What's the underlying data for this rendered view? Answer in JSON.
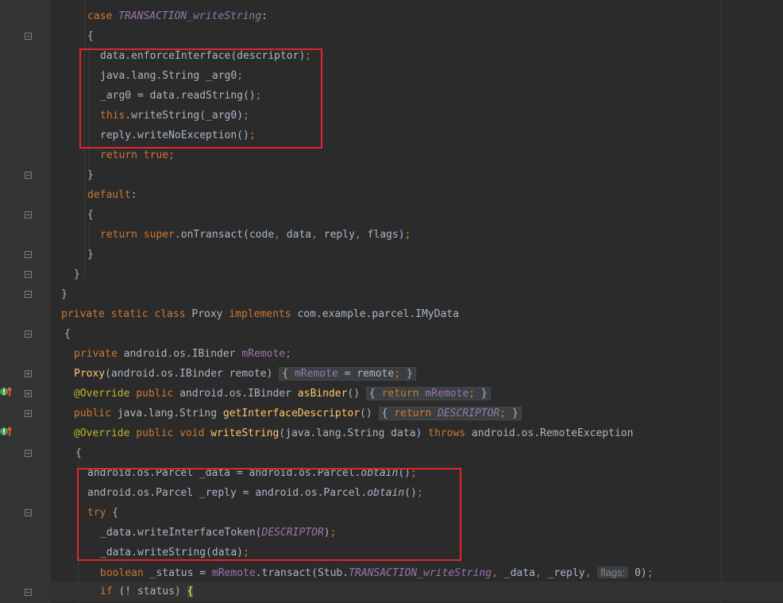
{
  "colors": {
    "background": "#2b2b2b",
    "keyword": "#cc7832",
    "field": "#9876aa",
    "method": "#ffc66d",
    "annotation": "#bbb529",
    "text": "#a9b7c6",
    "highlight_box": "#e0262c"
  },
  "code": {
    "l0": {
      "kw": "case",
      "const": "TRANSACTION_writeString",
      "rest": ":"
    },
    "l1": {
      "t": "{"
    },
    "l2": {
      "a": "data.enforceInterface(descriptor)",
      "b": ";"
    },
    "l3": {
      "a": "java.lang.String _arg0",
      "b": ";"
    },
    "l4": {
      "a": "_arg0 = data.readString()",
      "b": ";"
    },
    "l5": {
      "kw": "this",
      "a": ".writeString(_arg0)",
      "b": ";"
    },
    "l6": {
      "a": "reply.writeNoException()",
      "b": ";"
    },
    "l7": {
      "kw": "return true",
      "b": ";"
    },
    "l8": {
      "t": "}"
    },
    "l9": {
      "kw": "default",
      "rest": ":"
    },
    "l10": {
      "t": "{"
    },
    "l11": {
      "kw1": "return super",
      "a": ".onTransact(code",
      "c1": ",",
      "a2": " data",
      "c2": ",",
      "a3": " reply",
      "c3": ",",
      "a4": " flags)",
      "b": ";"
    },
    "l12": {
      "t": "}"
    },
    "l13": {
      "t": "}"
    },
    "l14": {
      "t": "}"
    },
    "l15": {
      "kw": "private static class",
      "name": " Proxy ",
      "kw2": "implements",
      "rest": " com.example.parcel.IMyData"
    },
    "l16": {
      "t": "{"
    },
    "l17": {
      "kw": "private",
      "type": " android.os.IBinder ",
      "fld": "mRemote",
      "b": ";"
    },
    "l18": {
      "fn": "Proxy",
      "a": "(android.os.IBinder remote) ",
      "f1": "{ ",
      "fld": "mRemote",
      "a2": " = remote",
      "b": ";",
      "f2": " }"
    },
    "l19": {
      "ann": "@Override",
      "kw": " public",
      "type": " android.os.IBinder ",
      "fn": "asBinder",
      "a": "() ",
      "f1": "{ ",
      "kw2": "return ",
      "fld": "mRemote",
      "b": ";",
      "f2": " }"
    },
    "l20": {
      "kw": "public",
      "type": " java.lang.String ",
      "fn": "getInterfaceDescriptor",
      "a": "() ",
      "f1": "{ ",
      "kw2": "return ",
      "fld": "DESCRIPTOR",
      "b": ";",
      "f2": " }"
    },
    "l21": {
      "ann": "@Override",
      "kw": " public void ",
      "fn": "writeString",
      "a": "(java.lang.String data) ",
      "kw2": "throws",
      "rest": " android.os.RemoteException"
    },
    "l22": {
      "t": "{"
    },
    "l23": {
      "a": "android.os.Parcel _data = android.os.Parcel.",
      "m": "obtain",
      "a2": "()",
      "b": ";"
    },
    "l24": {
      "a": "android.os.Parcel _reply = android.os.Parcel.",
      "m": "obtain",
      "a2": "()",
      "b": ";"
    },
    "l25": {
      "kw": "try",
      "a": " {"
    },
    "l26": {
      "a": "_data.writeInterfaceToken(",
      "fld": "DESCRIPTOR",
      "a2": ")",
      "b": ";"
    },
    "l27": {
      "a": "_data.writeString(data)",
      "b": ";"
    },
    "l28": {
      "kw": "boolean",
      "a": " _status = ",
      "fld": "mRemote",
      "a2": ".transact(Stub.",
      "c": "TRANSACTION_writeString",
      "c1": ",",
      "a3": " _data",
      "c2": ",",
      "a4": " _reply",
      "c3": ",",
      "hint": "flags:",
      "a5": " 0)",
      "b": ";"
    },
    "l29": {
      "kw": "if",
      "a": " (! status) ",
      "brace": "{"
    }
  }
}
